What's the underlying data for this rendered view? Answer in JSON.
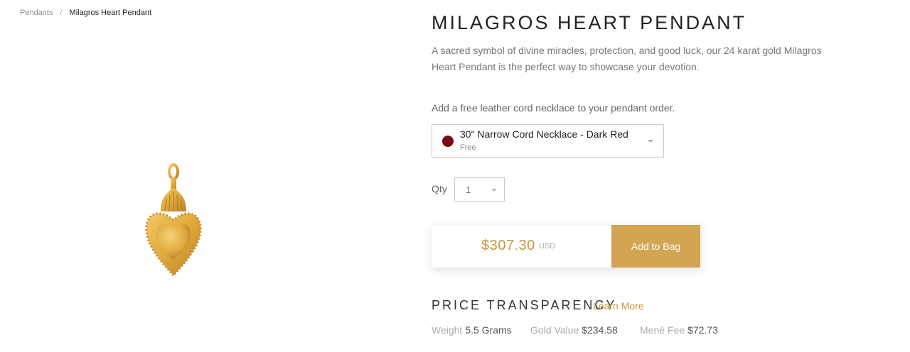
{
  "breadcrumb": {
    "parent": "Pendants",
    "separator": "/",
    "current": "Milagros Heart Pendant"
  },
  "product": {
    "title": "MILAGROS HEART PENDANT",
    "description": "A sacred symbol of divine miracles, protection, and good luck, our 24 karat gold Milagros Heart Pendant is the perfect way to showcase your devotion.",
    "image_icon": "heart-pendant-icon"
  },
  "cord": {
    "prompt": "Add a free leather cord necklace to your pendant order.",
    "selected_name": "30\" Narrow Cord Necklace - Dark Red",
    "selected_price": "Free",
    "swatch_color": "#7b0a12"
  },
  "qty": {
    "label": "Qty",
    "value": "1"
  },
  "buy": {
    "price": "$307.30",
    "currency": "USD",
    "button_label": "Add to Bag"
  },
  "transparency": {
    "title": "PRICE TRANSPARENCY",
    "learn_more": "Learn More",
    "weight_label": "Weight",
    "weight_value": "5.5 Grams",
    "gold_label": "Gold Value",
    "gold_value": "$234.58",
    "fee_label": "Menē Fee",
    "fee_value": "$72.73"
  },
  "colors": {
    "accent": "#c8963e",
    "button_bg": "#d3a452"
  }
}
